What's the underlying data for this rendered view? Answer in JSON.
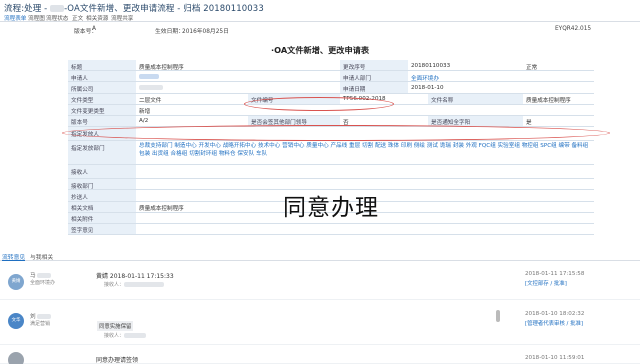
{
  "header": {
    "title_prefix": "流程:处理 - ",
    "title_main": "-OA文件新增、更改申请流程 - 归档 20180110033"
  },
  "nav": {
    "items": [
      "流程表单",
      "流程图",
      "流程状态",
      "正文",
      "相关资源",
      "流程共享"
    ]
  },
  "info": {
    "version_label": "版本号：",
    "version_value": "A",
    "effective_label": "生效日期：",
    "effective_value": "2016年08月25日",
    "doc_code": "EYQR42.015"
  },
  "form": {
    "title": "·OA文件新增、更改申请表",
    "rows": [
      {
        "l1": "标题",
        "v1": "质量成本控制程序",
        "l2": "更改序号",
        "v2": "20180110033",
        "v3": "正常"
      },
      {
        "l1": "申请人",
        "v1": "",
        "l2": "申请人部门",
        "v2": "全面环境办"
      },
      {
        "l1": "所属公司",
        "v1": "",
        "l2": "申请日期",
        "v2": "2018-01-10"
      },
      {
        "l1": "文件类型",
        "v1": "二层文件",
        "l2": "文件编号",
        "v2": "TP56.002-2018",
        "l3": "文件名称",
        "v3": "质量成本控制程序"
      },
      {
        "l1": "文件变更类型",
        "v1": "新增"
      },
      {
        "l1": "版本号",
        "v1": "A/2",
        "l2": "是否会签其他部门领导",
        "v2": "否",
        "l3": "是否通知全字阳",
        "v3": "是"
      },
      {
        "l1": "指定发放人"
      },
      {
        "l1": "指定发放部门",
        "v1": "总裁支持部门 制造中心 开发中心 战略开拓中心 技术中心 营销中心 质量中心 产品线 重层 切割 配送 珠体 印刷 侧绘 测试 诡瑞 封装 外观 FQC组 实验室组 物控组 SPC组 编带 备料组 包装 出货组 合格组 切割封环组 物料仓 保安队 车队"
      },
      {
        "l1": "接收人"
      },
      {
        "l1": "接收部门"
      },
      {
        "l1": "抄送人"
      },
      {
        "l1": "相关文档",
        "v1": "质量成本控制程序"
      },
      {
        "l1": "相关附件"
      },
      {
        "l1": "签字意见"
      }
    ]
  },
  "stamp": "同意办理",
  "tabs": [
    "流转意见",
    "与我相关"
  ],
  "logs": [
    {
      "avatar": "黄婧",
      "name": "马",
      "dept": "全面环境办",
      "action": "黄婧 2018-01-11 17:15:33",
      "sub": "接收人：",
      "time": "2018-01-11  17:15:58",
      "link": "[文控部存 / 批准]"
    },
    {
      "avatar": "文华",
      "name": "刘",
      "dept": "满足营销",
      "action": "",
      "note": "同意实施保留",
      "sub": "接收人：",
      "time": "2018-01-10  18:02:32",
      "link": "[管理者代表审核 / 批准]"
    },
    {
      "avatar": "",
      "name": "",
      "dept": "",
      "action": "同意办理请签领",
      "sub": "",
      "time": "2018-01-10  11:59:01",
      "link": ""
    }
  ],
  "colors": {
    "accent": "#1f6fc1",
    "label_bg": "#e8f0f8",
    "annotation": "#d9534f",
    "avatar1": "#7fa6cf",
    "avatar2": "#4a86c7",
    "avatar3": "#9aa3ad"
  }
}
